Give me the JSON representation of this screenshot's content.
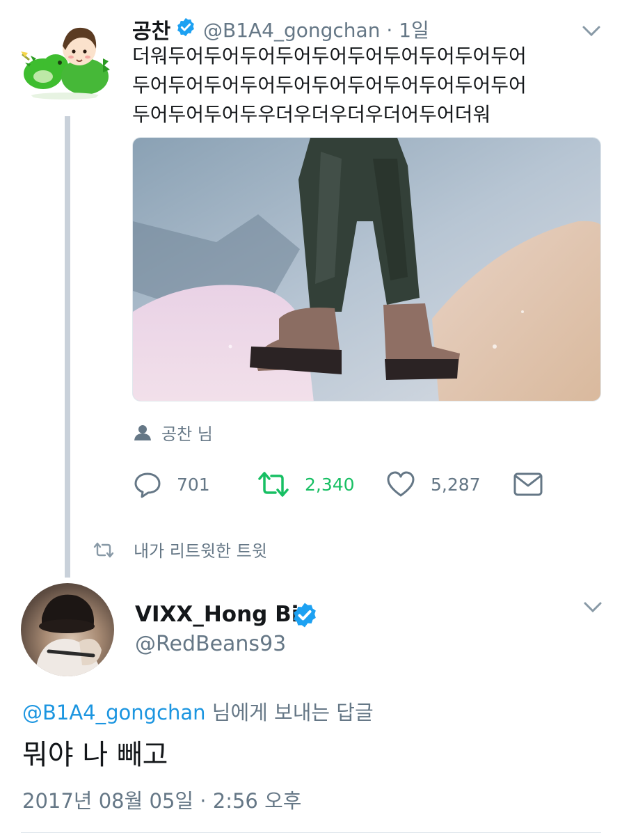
{
  "tweet": {
    "author_name": "공찬",
    "handle": "@B1A4_gongchan",
    "time_sep": "·",
    "time": "1일",
    "text_lines": [
      "더워두어두어두어두어두어두어두어두어두어두어",
      "두어두어두어두어두어두어두어두어두어두어두어",
      "두어두어두어두우더우더우더우더어두어더워"
    ],
    "tagged_user": "공찬 님",
    "stats": {
      "replies": "701",
      "retweets": "2,340",
      "likes": "5,287"
    }
  },
  "retweet_context": "내가 리트윗한 트윗",
  "reply": {
    "author_name": "VIXX_Hong Bin",
    "handle": "@RedBeans93",
    "replying_to_handle": "@B1A4_gongchan",
    "replying_to_suffix": " 님에게 보내는 답글",
    "text": "뭐야 나 빼고",
    "timestamp": "2017년 08월 05일 · 2:56 오후"
  },
  "icons": {
    "verified": "verified-badge-icon",
    "caret": "chevron-down-icon",
    "reply": "reply-bubble-icon",
    "retweet": "retweet-icon",
    "like": "heart-icon",
    "dm": "envelope-icon",
    "tag": "person-icon"
  },
  "colors": {
    "accent": "#1da1f2",
    "link": "#1b95e0",
    "retweet_active": "#17bf63",
    "muted": "#657786",
    "thread_line": "#c9d1da"
  }
}
